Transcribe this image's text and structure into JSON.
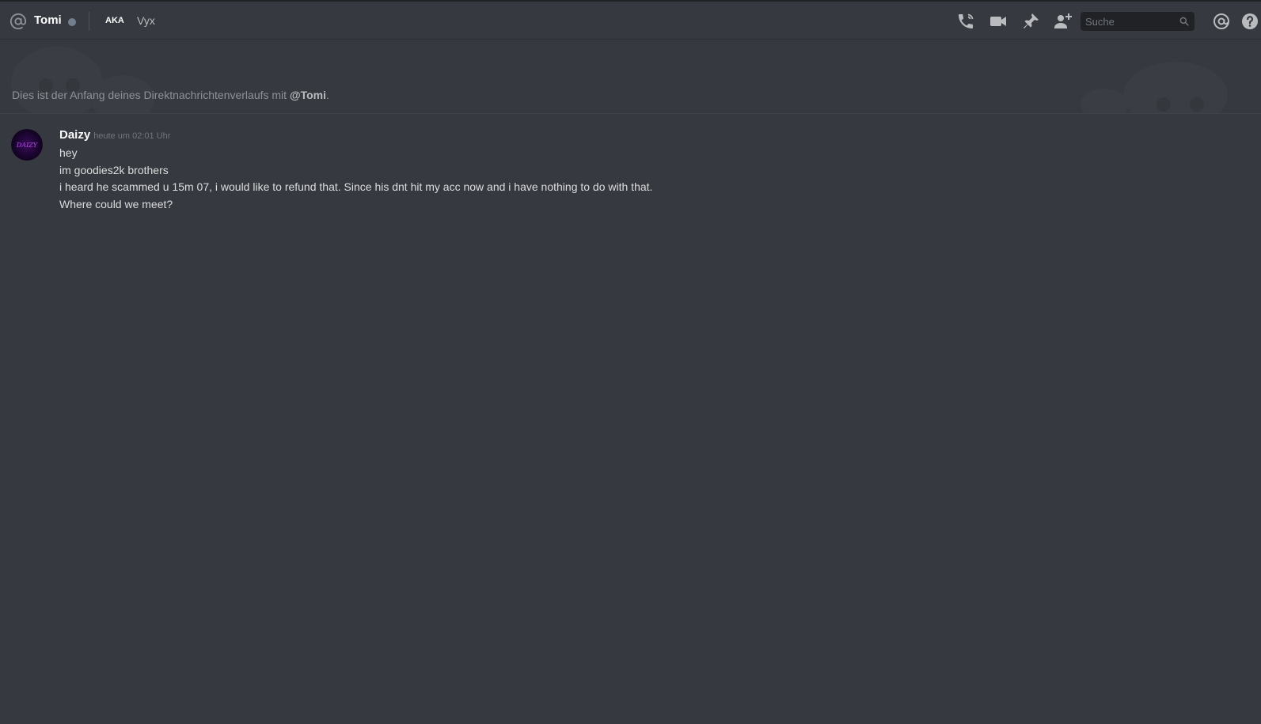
{
  "header": {
    "channel_name": "Tomi",
    "aka_label": "AKA",
    "nickname": "Vyx",
    "search_placeholder": "Suche",
    "icons": [
      "at-icon",
      "status-offline-icon",
      "voice-call-icon",
      "video-call-icon",
      "pinned-messages-icon",
      "add-friend-icon",
      "search-icon",
      "mentions-icon",
      "help-icon"
    ]
  },
  "welcome": {
    "prefix": "Dies ist der Anfang deines Direktnachrichtenverlaufs mit ",
    "mention": "@Tomi",
    "suffix": "."
  },
  "messages": [
    {
      "author": "Daizy",
      "timestamp": "heute um 02:01 Uhr",
      "avatar_text": "DAIZY",
      "lines": [
        "hey",
        "im goodies2k brothers",
        "i heard he scammed u 15m 07, i would like to refund that. Since his dnt hit my acc now and i have nothing to do with that.",
        "Where could we meet?"
      ]
    }
  ],
  "colors": {
    "background": "#36393f",
    "header_text": "#ffffff",
    "muted_text": "#8e9297",
    "message_text": "#dcddde",
    "timestamp": "#72767d",
    "status_offline": "#747f8d",
    "search_bg": "#202225"
  }
}
